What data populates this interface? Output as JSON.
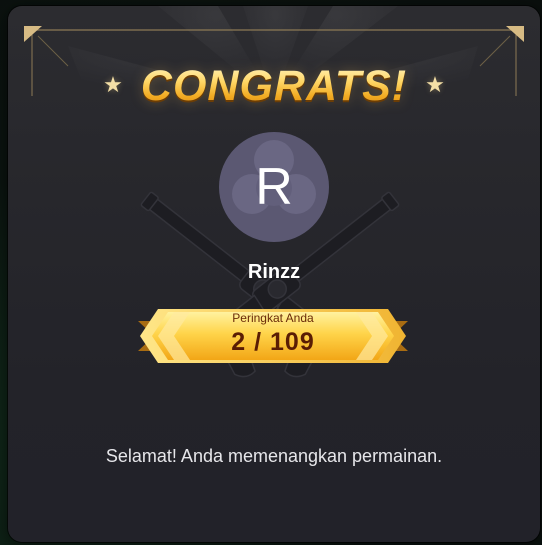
{
  "dialog": {
    "title": "CONGRATS!",
    "star_glyph": "★",
    "icons": [
      "star-icon",
      "crossed-revolvers-emblem",
      "avatar-clover-pattern",
      "chevron-right-icon",
      "chevron-left-icon"
    ]
  },
  "player": {
    "avatar_letter": "R",
    "name": "Rinzz"
  },
  "rank": {
    "label": "Peringkat Anda",
    "value": "2 / 109",
    "position": 2,
    "total": 109
  },
  "message": "Selamat! Anda memenangkan permainan.",
  "colors": {
    "panel": "#28282d",
    "gold_light": "#ffe27a",
    "gold_dark": "#f0a618",
    "rank_text": "#5a1d04",
    "avatar_bg": "#5b5872",
    "backdrop": "#0c1310"
  }
}
